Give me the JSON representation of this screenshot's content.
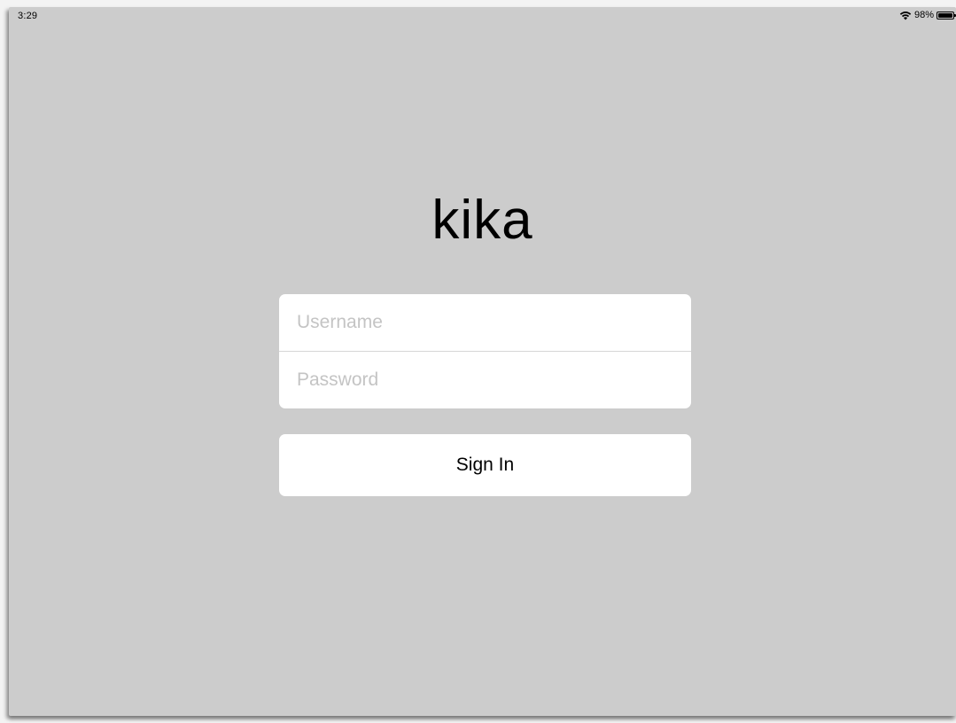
{
  "status_bar": {
    "time": "3:29",
    "battery_percent": "98%",
    "battery_level": 0.98,
    "wifi_icon": "wifi-icon",
    "battery_icon": "battery-icon"
  },
  "app": {
    "title": "kika"
  },
  "login_form": {
    "username": {
      "value": "",
      "placeholder": "Username"
    },
    "password": {
      "value": "",
      "placeholder": "Password"
    },
    "sign_in_label": "Sign In"
  },
  "colors": {
    "background": "#cccccc",
    "field_background": "#ffffff",
    "placeholder": "#c4c4c4",
    "text": "#000000"
  }
}
